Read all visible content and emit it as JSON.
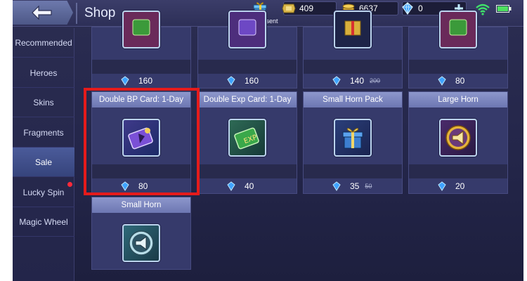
{
  "header": {
    "title": "Shop",
    "skin_present_label": "Skin Present",
    "currencies": {
      "ticket": "409",
      "gold": "6637",
      "diamond": "0"
    }
  },
  "sidebar": {
    "items": [
      {
        "label": "Recommended"
      },
      {
        "label": "Heroes"
      },
      {
        "label": "Skins"
      },
      {
        "label": "Fragments"
      },
      {
        "label": "Sale"
      },
      {
        "label": "Lucky Spin"
      },
      {
        "label": "Magic Wheel"
      }
    ],
    "active_index": 4
  },
  "top_row": [
    {
      "price": "160"
    },
    {
      "price": "160"
    },
    {
      "price": "140",
      "old_price": "200"
    },
    {
      "price": "80"
    }
  ],
  "items": [
    {
      "name": "Double BP Card: 1-Day",
      "price": "80",
      "icon": "bp-card-icon"
    },
    {
      "name": "Double Exp Card: 1-Day",
      "price": "40",
      "icon": "exp-card-icon"
    },
    {
      "name": "Small Horn Pack",
      "price": "35",
      "old_price": "50",
      "icon": "gift-box-icon"
    },
    {
      "name": "Large Horn",
      "price": "20",
      "icon": "megaphone-icon"
    },
    {
      "name": "Small Horn",
      "icon": "megaphone-icon"
    }
  ],
  "colors": {
    "highlight": "#e51b1b",
    "title_bar": "#7c86c0",
    "gem": "#3fa3ff"
  }
}
